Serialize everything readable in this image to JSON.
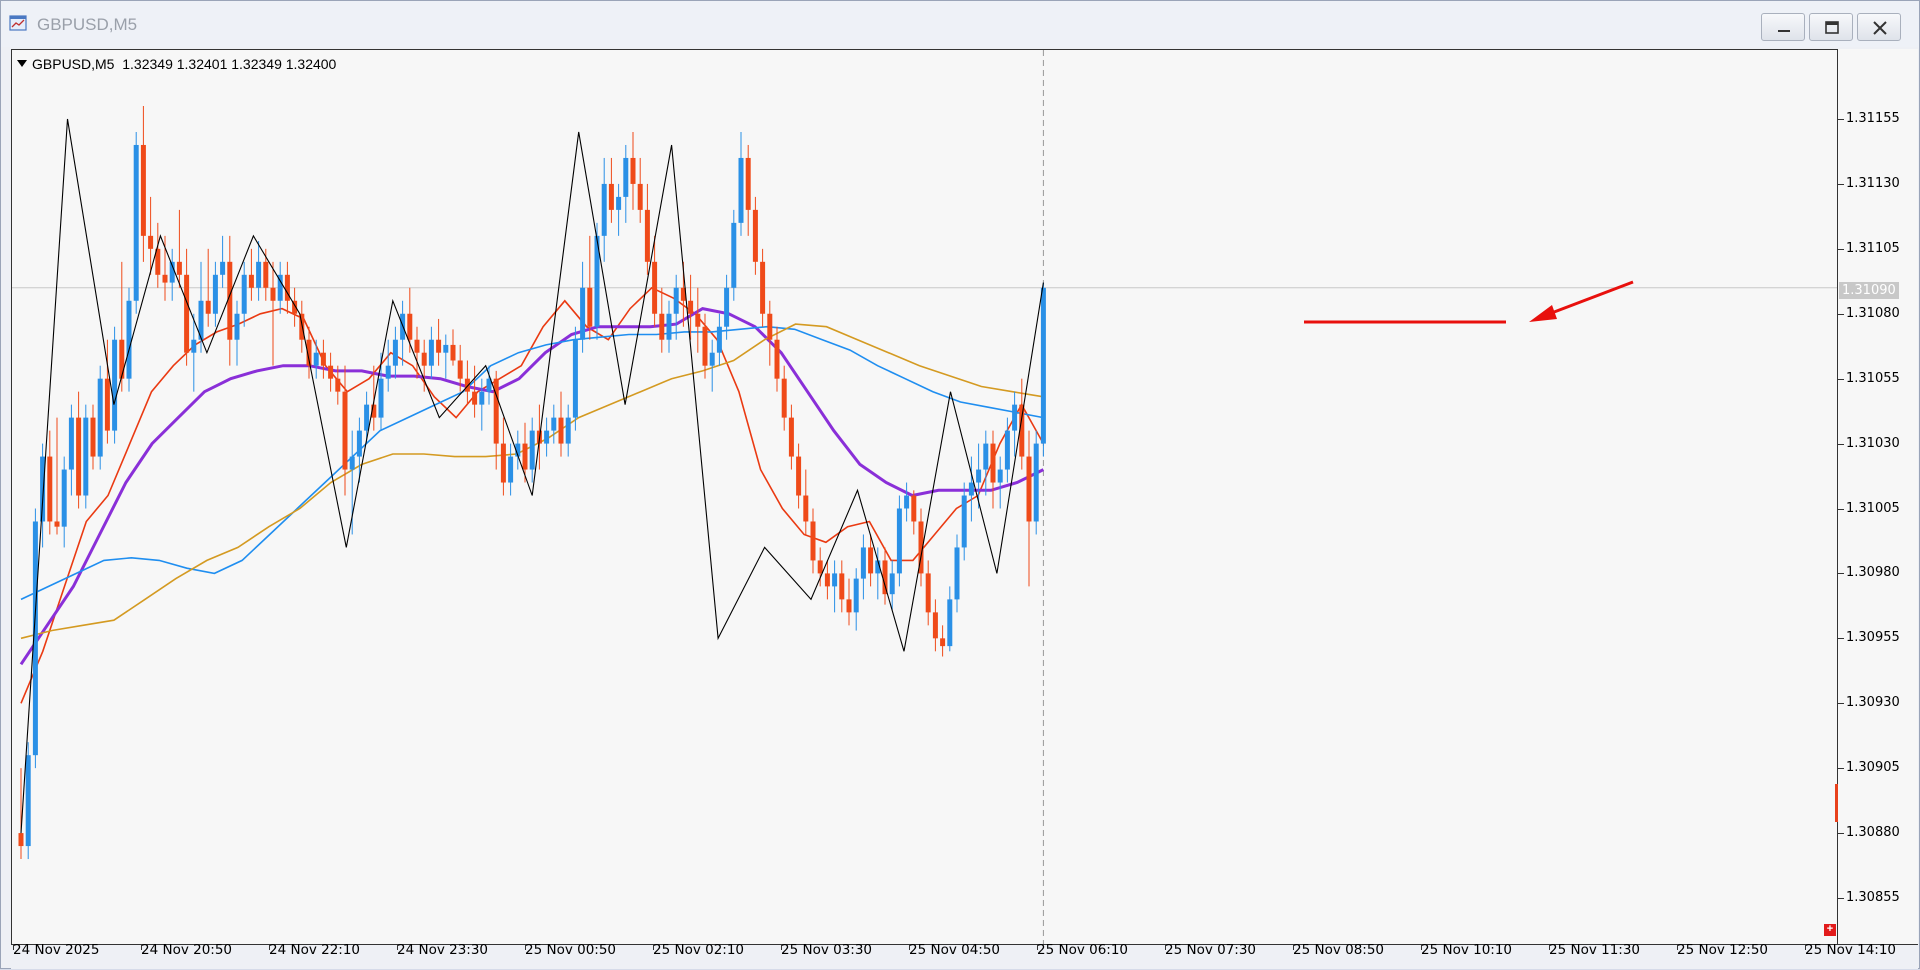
{
  "window": {
    "title": "GBPUSD,M5",
    "icons": [
      "chart-window-icon",
      "minimize-icon",
      "restore-icon",
      "close-icon"
    ]
  },
  "chart_header": {
    "symbol": "GBPUSD,M5",
    "ohlc": "1.32349 1.32401 1.32349 1.32400"
  },
  "colors": {
    "bull": "#2a90e6",
    "bear": "#ef4a19",
    "ma_fast": "#ea3a12",
    "ma_purple": "#8a2fd8",
    "ma_blue": "#1f8ef0",
    "ma_gold": "#d49a21",
    "zigzag": "#000000",
    "annotation": "#e8100d"
  },
  "price_axis": {
    "labels": [
      "1.31155",
      "1.31130",
      "1.31105",
      "1.31080",
      "1.31055",
      "1.31030",
      "1.31005",
      "1.30980",
      "1.30955",
      "1.30930",
      "1.30905",
      "1.30880",
      "1.30855"
    ],
    "current_price": "1.31090"
  },
  "time_axis": {
    "labels": [
      "24 Nov 2025",
      "24 Nov 20:50",
      "24 Nov 22:10",
      "24 Nov 23:30",
      "25 Nov 00:50",
      "25 Nov 02:10",
      "25 Nov 03:30",
      "25 Nov 04:50",
      "25 Nov 06:10",
      "25 Nov 07:30",
      "25 Nov 08:50",
      "25 Nov 10:10",
      "25 Nov 11:30",
      "25 Nov 12:50",
      "25 Nov 14:10"
    ]
  },
  "chart_data": {
    "type": "candlestick",
    "symbol": "GBPUSD",
    "timeframe": "M5",
    "ylim": [
      1.30845,
      1.31175
    ],
    "candles": [
      {
        "o": 1.3088,
        "h": 1.30905,
        "l": 1.3087,
        "c": 1.30875
      },
      {
        "o": 1.30875,
        "h": 1.30915,
        "l": 1.3087,
        "c": 1.3091
      },
      {
        "o": 1.3091,
        "h": 1.31005,
        "l": 1.30905,
        "c": 1.31
      },
      {
        "o": 1.31,
        "h": 1.3103,
        "l": 1.3099,
        "c": 1.31025
      },
      {
        "o": 1.31025,
        "h": 1.31035,
        "l": 1.30995,
        "c": 1.31
      },
      {
        "o": 1.31,
        "h": 1.3104,
        "l": 1.30995,
        "c": 1.30998
      },
      {
        "o": 1.30998,
        "h": 1.31025,
        "l": 1.3099,
        "c": 1.3102
      },
      {
        "o": 1.3102,
        "h": 1.31045,
        "l": 1.3101,
        "c": 1.3104
      },
      {
        "o": 1.3104,
        "h": 1.3105,
        "l": 1.31005,
        "c": 1.3101
      },
      {
        "o": 1.3101,
        "h": 1.31045,
        "l": 1.31005,
        "c": 1.3104
      },
      {
        "o": 1.3104,
        "h": 1.31045,
        "l": 1.3102,
        "c": 1.31025
      },
      {
        "o": 1.31025,
        "h": 1.3106,
        "l": 1.3102,
        "c": 1.31055
      },
      {
        "o": 1.31055,
        "h": 1.3107,
        "l": 1.3103,
        "c": 1.31035
      },
      {
        "o": 1.31035,
        "h": 1.31075,
        "l": 1.3103,
        "c": 1.3107
      },
      {
        "o": 1.3107,
        "h": 1.311,
        "l": 1.3105,
        "c": 1.31055
      },
      {
        "o": 1.31055,
        "h": 1.3109,
        "l": 1.3105,
        "c": 1.31085
      },
      {
        "o": 1.31085,
        "h": 1.3115,
        "l": 1.3108,
        "c": 1.31145
      },
      {
        "o": 1.31145,
        "h": 1.3116,
        "l": 1.311,
        "c": 1.3111
      },
      {
        "o": 1.3111,
        "h": 1.31125,
        "l": 1.31095,
        "c": 1.31105
      },
      {
        "o": 1.31105,
        "h": 1.31115,
        "l": 1.3109,
        "c": 1.31095
      },
      {
        "o": 1.31095,
        "h": 1.3111,
        "l": 1.31085,
        "c": 1.31092
      },
      {
        "o": 1.31092,
        "h": 1.31105,
        "l": 1.31085,
        "c": 1.311
      },
      {
        "o": 1.311,
        "h": 1.3112,
        "l": 1.3109,
        "c": 1.31095
      },
      {
        "o": 1.31095,
        "h": 1.31105,
        "l": 1.3106,
        "c": 1.31065
      },
      {
        "o": 1.31065,
        "h": 1.3108,
        "l": 1.3105,
        "c": 1.3107
      },
      {
        "o": 1.3107,
        "h": 1.311,
        "l": 1.31065,
        "c": 1.31085
      },
      {
        "o": 1.31085,
        "h": 1.31105,
        "l": 1.31075,
        "c": 1.3108
      },
      {
        "o": 1.3108,
        "h": 1.311,
        "l": 1.31075,
        "c": 1.31095
      },
      {
        "o": 1.31095,
        "h": 1.3111,
        "l": 1.3109,
        "c": 1.311
      },
      {
        "o": 1.311,
        "h": 1.3111,
        "l": 1.3106,
        "c": 1.3107
      },
      {
        "o": 1.3107,
        "h": 1.31085,
        "l": 1.3106,
        "c": 1.3108
      },
      {
        "o": 1.3108,
        "h": 1.311,
        "l": 1.31075,
        "c": 1.31095
      },
      {
        "o": 1.31095,
        "h": 1.31105,
        "l": 1.31085,
        "c": 1.3109
      },
      {
        "o": 1.3109,
        "h": 1.31108,
        "l": 1.31085,
        "c": 1.311
      },
      {
        "o": 1.311,
        "h": 1.31105,
        "l": 1.31085,
        "c": 1.3109
      },
      {
        "o": 1.3109,
        "h": 1.311,
        "l": 1.3106,
        "c": 1.31085
      },
      {
        "o": 1.31085,
        "h": 1.311,
        "l": 1.3108,
        "c": 1.31095
      },
      {
        "o": 1.31095,
        "h": 1.311,
        "l": 1.3108,
        "c": 1.31085
      },
      {
        "o": 1.31085,
        "h": 1.3109,
        "l": 1.31075,
        "c": 1.3108
      },
      {
        "o": 1.3108,
        "h": 1.31085,
        "l": 1.31065,
        "c": 1.3107
      },
      {
        "o": 1.3107,
        "h": 1.31075,
        "l": 1.31055,
        "c": 1.3106
      },
      {
        "o": 1.3106,
        "h": 1.3107,
        "l": 1.31055,
        "c": 1.31065
      },
      {
        "o": 1.31065,
        "h": 1.3107,
        "l": 1.31055,
        "c": 1.3106
      },
      {
        "o": 1.3106,
        "h": 1.31065,
        "l": 1.3105,
        "c": 1.31055
      },
      {
        "o": 1.31055,
        "h": 1.3106,
        "l": 1.31045,
        "c": 1.3105
      },
      {
        "o": 1.3105,
        "h": 1.3106,
        "l": 1.3101,
        "c": 1.3102
      },
      {
        "o": 1.3102,
        "h": 1.31035,
        "l": 1.30995,
        "c": 1.31025
      },
      {
        "o": 1.31025,
        "h": 1.3104,
        "l": 1.31015,
        "c": 1.31035
      },
      {
        "o": 1.31035,
        "h": 1.3105,
        "l": 1.3103,
        "c": 1.31045
      },
      {
        "o": 1.31045,
        "h": 1.3106,
        "l": 1.31035,
        "c": 1.3104
      },
      {
        "o": 1.3104,
        "h": 1.31065,
        "l": 1.31035,
        "c": 1.31055
      },
      {
        "o": 1.31055,
        "h": 1.3107,
        "l": 1.3105,
        "c": 1.3106
      },
      {
        "o": 1.3106,
        "h": 1.31075,
        "l": 1.31055,
        "c": 1.3107
      },
      {
        "o": 1.3107,
        "h": 1.31085,
        "l": 1.3106,
        "c": 1.3108
      },
      {
        "o": 1.3108,
        "h": 1.3109,
        "l": 1.31065,
        "c": 1.3107
      },
      {
        "o": 1.3107,
        "h": 1.31075,
        "l": 1.31055,
        "c": 1.31065
      },
      {
        "o": 1.31065,
        "h": 1.3107,
        "l": 1.3105,
        "c": 1.3106
      },
      {
        "o": 1.3106,
        "h": 1.31075,
        "l": 1.31055,
        "c": 1.3107
      },
      {
        "o": 1.3107,
        "h": 1.31078,
        "l": 1.3106,
        "c": 1.31065
      },
      {
        "o": 1.31065,
        "h": 1.31072,
        "l": 1.31055,
        "c": 1.31068
      },
      {
        "o": 1.31068,
        "h": 1.31074,
        "l": 1.3106,
        "c": 1.31062
      },
      {
        "o": 1.31062,
        "h": 1.31068,
        "l": 1.3105,
        "c": 1.31055
      },
      {
        "o": 1.31055,
        "h": 1.31062,
        "l": 1.31045,
        "c": 1.3105
      },
      {
        "o": 1.3105,
        "h": 1.3106,
        "l": 1.3104,
        "c": 1.31045
      },
      {
        "o": 1.31045,
        "h": 1.31055,
        "l": 1.31035,
        "c": 1.3105
      },
      {
        "o": 1.3105,
        "h": 1.3106,
        "l": 1.31045,
        "c": 1.31055
      },
      {
        "o": 1.31055,
        "h": 1.31058,
        "l": 1.3102,
        "c": 1.3103
      },
      {
        "o": 1.3103,
        "h": 1.3104,
        "l": 1.3101,
        "c": 1.31015
      },
      {
        "o": 1.31015,
        "h": 1.3103,
        "l": 1.3101,
        "c": 1.31025
      },
      {
        "o": 1.31025,
        "h": 1.31035,
        "l": 1.3102,
        "c": 1.3103
      },
      {
        "o": 1.3103,
        "h": 1.31038,
        "l": 1.31015,
        "c": 1.3102
      },
      {
        "o": 1.3102,
        "h": 1.3104,
        "l": 1.31015,
        "c": 1.31035
      },
      {
        "o": 1.31035,
        "h": 1.31045,
        "l": 1.3102,
        "c": 1.3103
      },
      {
        "o": 1.3103,
        "h": 1.3104,
        "l": 1.31025,
        "c": 1.31035
      },
      {
        "o": 1.31035,
        "h": 1.31045,
        "l": 1.3103,
        "c": 1.3104
      },
      {
        "o": 1.3104,
        "h": 1.3105,
        "l": 1.31025,
        "c": 1.3103
      },
      {
        "o": 1.3103,
        "h": 1.31045,
        "l": 1.31025,
        "c": 1.3104
      },
      {
        "o": 1.3104,
        "h": 1.31075,
        "l": 1.31035,
        "c": 1.3107
      },
      {
        "o": 1.3107,
        "h": 1.311,
        "l": 1.31065,
        "c": 1.3109
      },
      {
        "o": 1.3109,
        "h": 1.3111,
        "l": 1.3107,
        "c": 1.31075
      },
      {
        "o": 1.31075,
        "h": 1.31115,
        "l": 1.3107,
        "c": 1.3111
      },
      {
        "o": 1.3111,
        "h": 1.3114,
        "l": 1.311,
        "c": 1.3113
      },
      {
        "o": 1.3113,
        "h": 1.3114,
        "l": 1.31115,
        "c": 1.3112
      },
      {
        "o": 1.3112,
        "h": 1.3113,
        "l": 1.3111,
        "c": 1.31125
      },
      {
        "o": 1.31125,
        "h": 1.31145,
        "l": 1.31115,
        "c": 1.3114
      },
      {
        "o": 1.3114,
        "h": 1.3115,
        "l": 1.3112,
        "c": 1.3113
      },
      {
        "o": 1.3113,
        "h": 1.3114,
        "l": 1.31115,
        "c": 1.3112
      },
      {
        "o": 1.3112,
        "h": 1.3113,
        "l": 1.31095,
        "c": 1.311
      },
      {
        "o": 1.311,
        "h": 1.3111,
        "l": 1.31075,
        "c": 1.3108
      },
      {
        "o": 1.3108,
        "h": 1.3109,
        "l": 1.31065,
        "c": 1.3107
      },
      {
        "o": 1.3107,
        "h": 1.31085,
        "l": 1.31065,
        "c": 1.3108
      },
      {
        "o": 1.3108,
        "h": 1.31095,
        "l": 1.3107,
        "c": 1.3109
      },
      {
        "o": 1.3109,
        "h": 1.311,
        "l": 1.31075,
        "c": 1.31085
      },
      {
        "o": 1.31085,
        "h": 1.31095,
        "l": 1.3107,
        "c": 1.3108
      },
      {
        "o": 1.3108,
        "h": 1.3109,
        "l": 1.31065,
        "c": 1.31075
      },
      {
        "o": 1.31075,
        "h": 1.3108,
        "l": 1.31055,
        "c": 1.3106
      },
      {
        "o": 1.3106,
        "h": 1.3107,
        "l": 1.3105,
        "c": 1.31065
      },
      {
        "o": 1.31065,
        "h": 1.3108,
        "l": 1.3106,
        "c": 1.31075
      },
      {
        "o": 1.31075,
        "h": 1.31095,
        "l": 1.3107,
        "c": 1.3109
      },
      {
        "o": 1.3109,
        "h": 1.3112,
        "l": 1.31085,
        "c": 1.31115
      },
      {
        "o": 1.31115,
        "h": 1.3115,
        "l": 1.3111,
        "c": 1.3114
      },
      {
        "o": 1.3114,
        "h": 1.31145,
        "l": 1.3111,
        "c": 1.3112
      },
      {
        "o": 1.3112,
        "h": 1.31125,
        "l": 1.31095,
        "c": 1.311
      },
      {
        "o": 1.311,
        "h": 1.31105,
        "l": 1.31075,
        "c": 1.3108
      },
      {
        "o": 1.3108,
        "h": 1.31085,
        "l": 1.3106,
        "c": 1.3107
      },
      {
        "o": 1.3107,
        "h": 1.31075,
        "l": 1.3105,
        "c": 1.31055
      },
      {
        "o": 1.31055,
        "h": 1.3106,
        "l": 1.31035,
        "c": 1.3104
      },
      {
        "o": 1.3104,
        "h": 1.31045,
        "l": 1.3102,
        "c": 1.31025
      },
      {
        "o": 1.31025,
        "h": 1.3103,
        "l": 1.31005,
        "c": 1.3101
      },
      {
        "o": 1.3101,
        "h": 1.3102,
        "l": 1.30995,
        "c": 1.31
      },
      {
        "o": 1.31,
        "h": 1.31005,
        "l": 1.3098,
        "c": 1.30985
      },
      {
        "o": 1.30985,
        "h": 1.3099,
        "l": 1.30975,
        "c": 1.3098
      },
      {
        "o": 1.3098,
        "h": 1.30985,
        "l": 1.3097,
        "c": 1.30975
      },
      {
        "o": 1.30975,
        "h": 1.30985,
        "l": 1.30965,
        "c": 1.3098
      },
      {
        "o": 1.3098,
        "h": 1.30985,
        "l": 1.30965,
        "c": 1.3097
      },
      {
        "o": 1.3097,
        "h": 1.30978,
        "l": 1.3096,
        "c": 1.30965
      },
      {
        "o": 1.30965,
        "h": 1.30982,
        "l": 1.30958,
        "c": 1.30978
      },
      {
        "o": 1.30978,
        "h": 1.30995,
        "l": 1.3097,
        "c": 1.3099
      },
      {
        "o": 1.3099,
        "h": 1.30995,
        "l": 1.30975,
        "c": 1.3098
      },
      {
        "o": 1.3098,
        "h": 1.3099,
        "l": 1.3097,
        "c": 1.30985
      },
      {
        "o": 1.30985,
        "h": 1.3099,
        "l": 1.30968,
        "c": 1.30972
      },
      {
        "o": 1.30972,
        "h": 1.30985,
        "l": 1.30966,
        "c": 1.3098
      },
      {
        "o": 1.3098,
        "h": 1.3101,
        "l": 1.30975,
        "c": 1.31005
      },
      {
        "o": 1.31005,
        "h": 1.31015,
        "l": 1.31,
        "c": 1.3101
      },
      {
        "o": 1.3101,
        "h": 1.31012,
        "l": 1.30995,
        "c": 1.31
      },
      {
        "o": 1.31,
        "h": 1.31005,
        "l": 1.30975,
        "c": 1.3098
      },
      {
        "o": 1.3098,
        "h": 1.30985,
        "l": 1.3096,
        "c": 1.30965
      },
      {
        "o": 1.30965,
        "h": 1.3097,
        "l": 1.3095,
        "c": 1.30955
      },
      {
        "o": 1.30955,
        "h": 1.3096,
        "l": 1.30948,
        "c": 1.30952
      },
      {
        "o": 1.30952,
        "h": 1.30975,
        "l": 1.3095,
        "c": 1.3097
      },
      {
        "o": 1.3097,
        "h": 1.30995,
        "l": 1.30965,
        "c": 1.3099
      },
      {
        "o": 1.3099,
        "h": 1.31015,
        "l": 1.30985,
        "c": 1.3101
      },
      {
        "o": 1.3101,
        "h": 1.31025,
        "l": 1.31,
        "c": 1.31015
      },
      {
        "o": 1.31015,
        "h": 1.3103,
        "l": 1.31005,
        "c": 1.3102
      },
      {
        "o": 1.3102,
        "h": 1.31035,
        "l": 1.3101,
        "c": 1.3103
      },
      {
        "o": 1.3103,
        "h": 1.31035,
        "l": 1.31005,
        "c": 1.31015
      },
      {
        "o": 1.31015,
        "h": 1.31025,
        "l": 1.31005,
        "c": 1.3102
      },
      {
        "o": 1.3102,
        "h": 1.3104,
        "l": 1.31015,
        "c": 1.31035
      },
      {
        "o": 1.31035,
        "h": 1.3105,
        "l": 1.31025,
        "c": 1.31045
      },
      {
        "o": 1.31045,
        "h": 1.31055,
        "l": 1.3102,
        "c": 1.31025
      },
      {
        "o": 1.31025,
        "h": 1.31035,
        "l": 1.30975,
        "c": 1.31
      },
      {
        "o": 1.31,
        "h": 1.31035,
        "l": 1.30995,
        "c": 1.3103
      },
      {
        "o": 1.3103,
        "h": 1.31092,
        "l": 1.31025,
        "c": 1.3109
      }
    ],
    "moving_averages": [
      {
        "name": "fast",
        "color": "#ea3a12",
        "values": [
          1.3093,
          1.3095,
          1.30975,
          1.31,
          1.3101,
          1.3103,
          1.3105,
          1.3106,
          1.31068,
          1.31073,
          1.31076,
          1.3108,
          1.31082,
          1.31078,
          1.3106,
          1.3105,
          1.31055,
          1.31065,
          1.3106,
          1.31048,
          1.3104,
          1.3105,
          1.31055,
          1.3106,
          1.31075,
          1.31085,
          1.31075,
          1.3107,
          1.31082,
          1.3109,
          1.31086,
          1.3108,
          1.3107,
          1.3105,
          1.3102,
          1.31005,
          1.30995,
          1.30992,
          1.30998,
          1.31,
          1.30985,
          1.30985,
          1.30995,
          1.31005,
          1.3101,
          1.3103,
          1.31045,
          1.3103
        ]
      },
      {
        "name": "purple",
        "color": "#8a2fd8",
        "values": [
          1.30945,
          1.3096,
          1.30975,
          1.30995,
          1.31015,
          1.3103,
          1.3104,
          1.3105,
          1.31055,
          1.31058,
          1.3106,
          1.3106,
          1.31058,
          1.31058,
          1.31056,
          1.31056,
          1.31055,
          1.31052,
          1.3105,
          1.31055,
          1.31065,
          1.31072,
          1.31075,
          1.31075,
          1.31075,
          1.31076,
          1.31082,
          1.3108,
          1.31075,
          1.31065,
          1.3105,
          1.31035,
          1.31022,
          1.31015,
          1.3101,
          1.31012,
          1.31012,
          1.31012,
          1.31015,
          1.3102
        ]
      },
      {
        "name": "blue",
        "color": "#1f8ef0",
        "values": [
          1.3097,
          1.30975,
          1.3098,
          1.30985,
          1.30986,
          1.30985,
          1.30982,
          1.3098,
          1.30985,
          1.30995,
          1.31005,
          1.31015,
          1.31025,
          1.31035,
          1.3104,
          1.31045,
          1.3105,
          1.3106,
          1.31065,
          1.31068,
          1.3107,
          1.31071,
          1.31072,
          1.31072,
          1.31073,
          1.31073,
          1.31074,
          1.31075,
          1.31074,
          1.3107,
          1.31066,
          1.3106,
          1.31055,
          1.3105,
          1.31046,
          1.31044,
          1.31042,
          1.3104
        ]
      },
      {
        "name": "gold",
        "color": "#d49a21",
        "values": [
          1.30955,
          1.30958,
          1.3096,
          1.30962,
          1.3097,
          1.30978,
          1.30985,
          1.3099,
          1.30998,
          1.31005,
          1.31015,
          1.31022,
          1.31026,
          1.31026,
          1.31025,
          1.31025,
          1.31026,
          1.31032,
          1.3104,
          1.31045,
          1.3105,
          1.31055,
          1.31058,
          1.31062,
          1.3107,
          1.31076,
          1.31075,
          1.3107,
          1.31065,
          1.3106,
          1.31056,
          1.31052,
          1.3105,
          1.31048
        ]
      }
    ],
    "zigzag": [
      1.3088,
      1.31155,
      1.31045,
      1.3111,
      1.31065,
      1.3111,
      1.3108,
      1.3099,
      1.31085,
      1.3104,
      1.3106,
      1.3101,
      1.3115,
      1.31045,
      1.31145,
      1.30955,
      1.3099,
      1.3097,
      1.31012,
      1.3095,
      1.3105,
      1.3098,
      1.31092
    ]
  }
}
